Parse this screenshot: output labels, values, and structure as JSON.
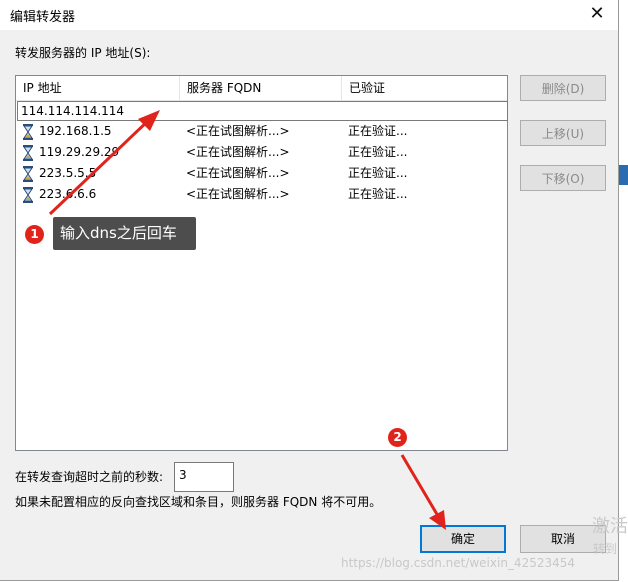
{
  "dialog": {
    "title": "编辑转发器",
    "close_glyph": "✕",
    "list_caption": "转发服务器的 IP 地址(S):",
    "columns": [
      "IP 地址",
      "服务器 FQDN",
      "已验证"
    ],
    "editing_value": "114.114.114.114",
    "rows": [
      {
        "ip": "192.168.1.5",
        "fqdn": "<正在试图解析...>",
        "verified": "正在验证..."
      },
      {
        "ip": "119.29.29.29",
        "fqdn": "<正在试图解析...>",
        "verified": "正在验证..."
      },
      {
        "ip": "223.5.5.5",
        "fqdn": "<正在试图解析...>",
        "verified": "正在验证..."
      },
      {
        "ip": "223.6.6.6",
        "fqdn": "<正在试图解析...>",
        "verified": "正在验证..."
      }
    ],
    "side_buttons": {
      "delete": "删除(D)",
      "move_up": "上移(U)",
      "move_down": "下移(O)"
    },
    "timeout_label": "在转发查询超时之前的秒数:",
    "timeout_value": "3",
    "note": "如果未配置相应的反向查找区域和条目，则服务器 FQDN 将不可用。",
    "ok_label": "确定",
    "cancel_label": "取消"
  },
  "annotations": {
    "badge1": "1",
    "callout1": "输入dns之后回车",
    "badge2": "2",
    "color_red": "#e0241b"
  },
  "watermark": {
    "url": "https://blog.csdn.net/weixin_42523454",
    "activate_1": "激活",
    "activate_2": "转到"
  },
  "icons": {
    "row_icon": "hourglass-icon"
  }
}
